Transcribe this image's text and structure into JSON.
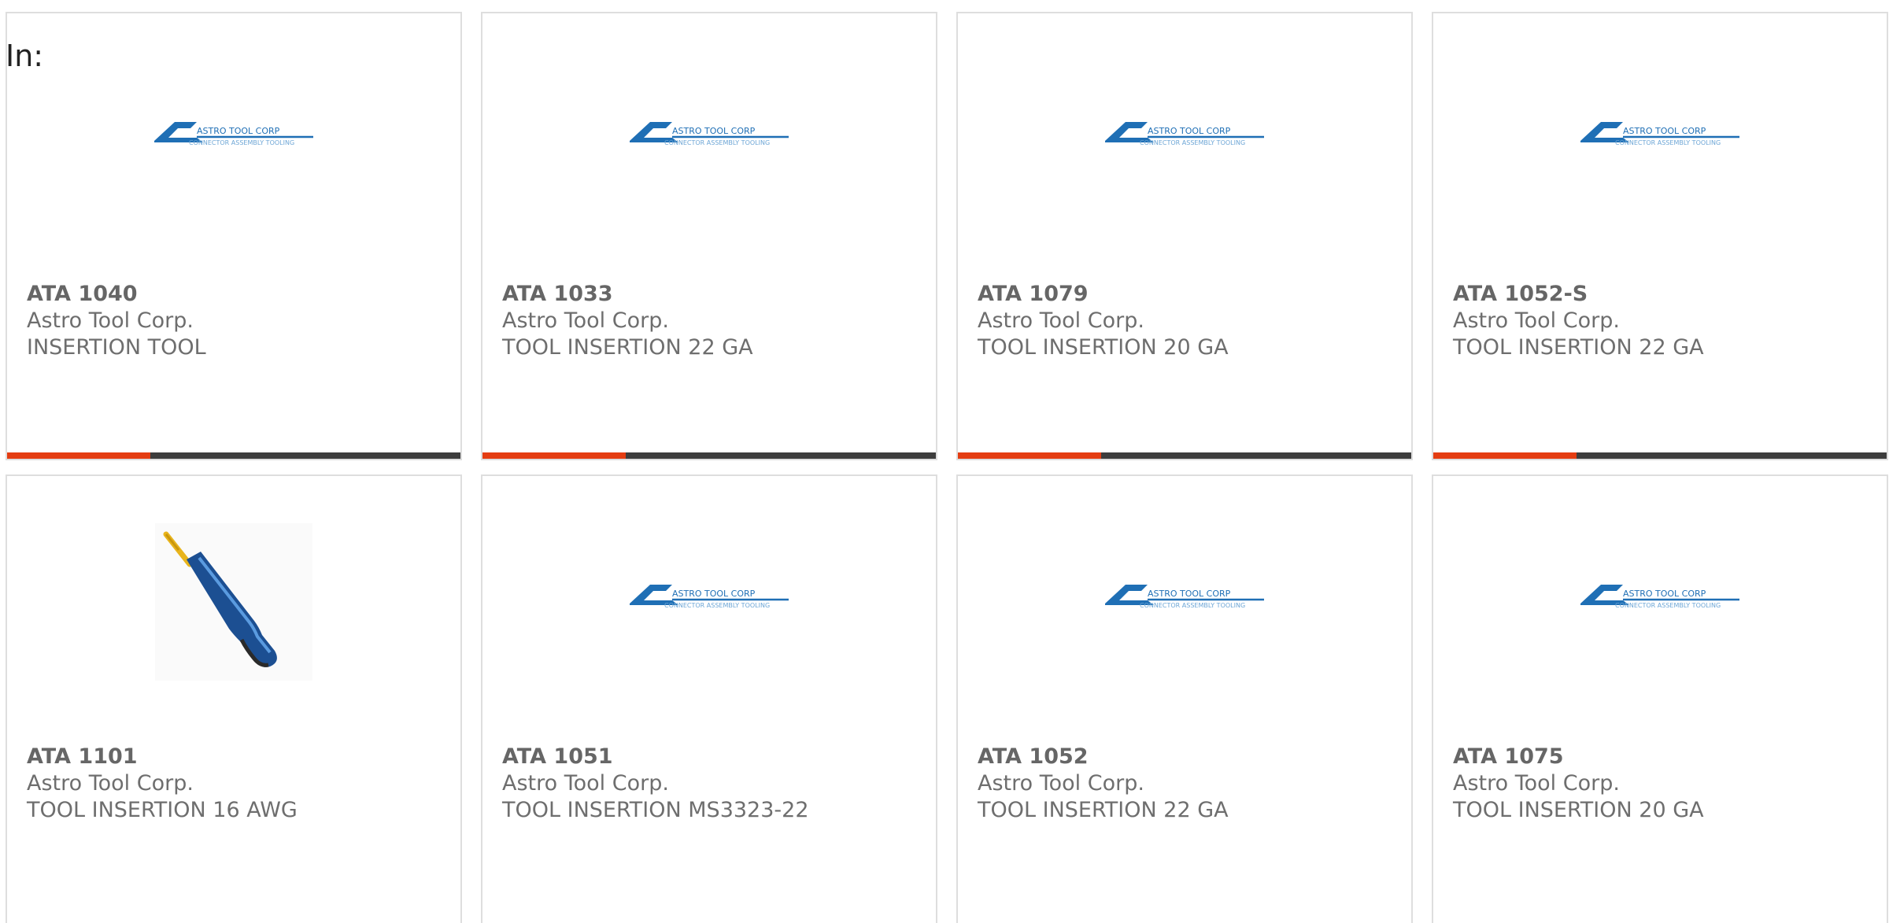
{
  "filter": {
    "label": "In:"
  },
  "brand_logo": {
    "line1": "ASTRO TOOL CORP",
    "line2": "CONNECTOR ASSEMBLY TOOLING"
  },
  "colors": {
    "accent": "#e43d12",
    "bar": "#3d3d3d",
    "logo_blue": "#1f6fb5"
  },
  "products": [
    {
      "part": "ATA 1040",
      "maker": "Astro Tool Corp.",
      "desc": "INSERTION TOOL",
      "image": "astro-logo"
    },
    {
      "part": "ATA 1033",
      "maker": "Astro Tool Corp.",
      "desc": "TOOL INSERTION 22 GA",
      "image": "astro-logo"
    },
    {
      "part": "ATA 1079",
      "maker": "Astro Tool Corp.",
      "desc": "TOOL INSERTION 20 GA",
      "image": "astro-logo"
    },
    {
      "part": "ATA 1052-S",
      "maker": "Astro Tool Corp.",
      "desc": "TOOL INSERTION 22 GA",
      "image": "astro-logo"
    },
    {
      "part": "ATA 1101",
      "maker": "Astro Tool Corp.",
      "desc": "TOOL INSERTION 16 AWG",
      "image": "insertion-tool-photo"
    },
    {
      "part": "ATA 1051",
      "maker": "Astro Tool Corp.",
      "desc": "TOOL INSERTION MS3323-22",
      "image": "astro-logo"
    },
    {
      "part": "ATA 1052",
      "maker": "Astro Tool Corp.",
      "desc": "TOOL INSERTION 22 GA",
      "image": "astro-logo"
    },
    {
      "part": "ATA 1075",
      "maker": "Astro Tool Corp.",
      "desc": "TOOL INSERTION 20 GA",
      "image": "astro-logo"
    }
  ]
}
